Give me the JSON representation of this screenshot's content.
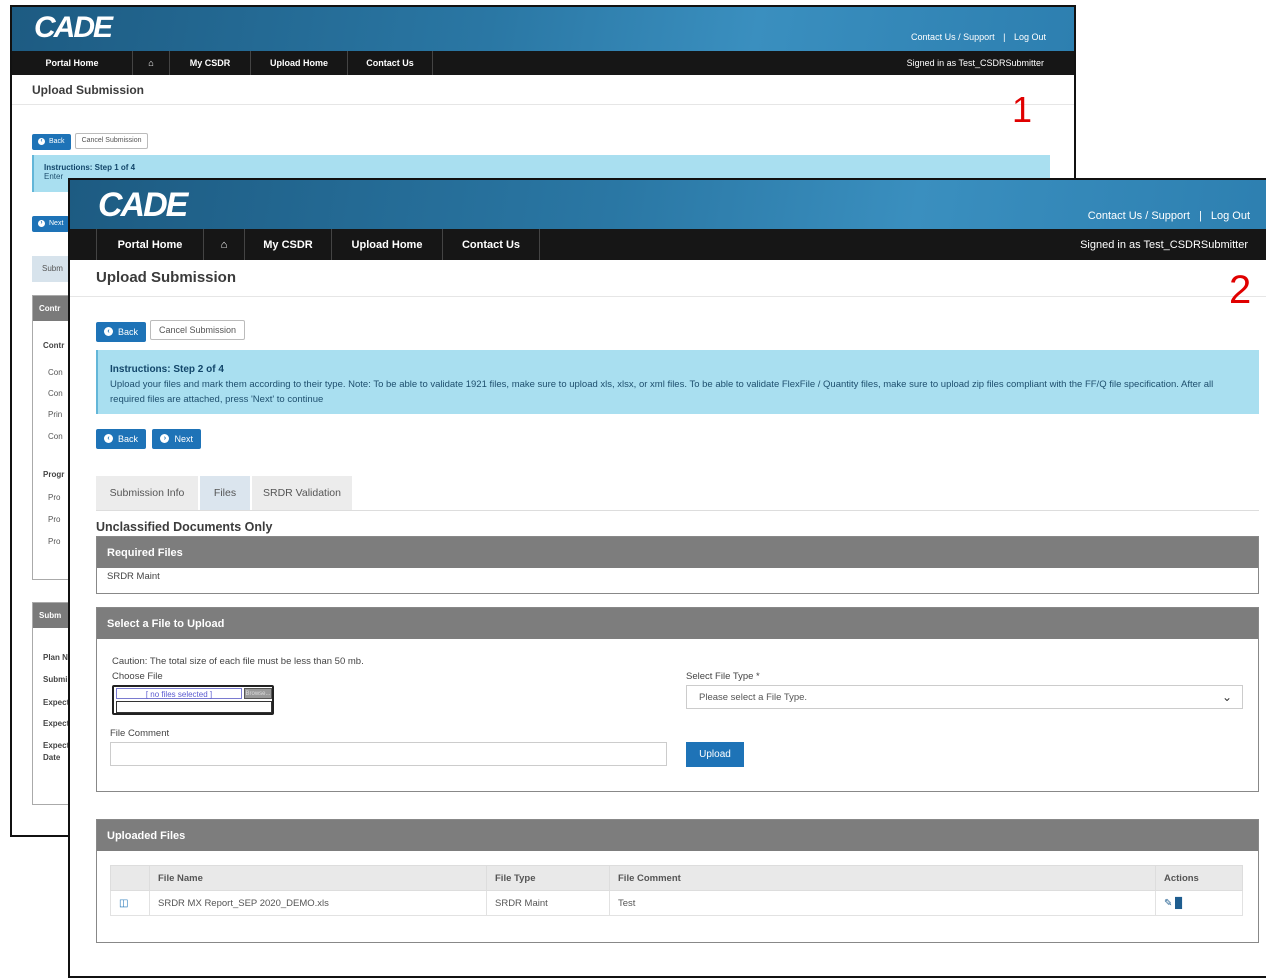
{
  "app": {
    "logo": "CADE"
  },
  "windows": [
    {
      "label": "1",
      "top_links": {
        "contact": "Contact Us / Support",
        "sep": "|",
        "logout": "Log Out"
      },
      "nav": [
        "Portal Home",
        "⌂",
        "My CSDR",
        "Upload Home",
        "Contact Us"
      ],
      "signed_in": "Signed in as Test_CSDRSubmitter",
      "page_title": "Upload Submission",
      "buttons": {
        "back": "Back",
        "cancel": "Cancel Submission",
        "next": "Next"
      },
      "instructions": {
        "title": "Instructions: Step 1 of 4",
        "text": "Enter"
      },
      "tab_stub": "Subm",
      "panel1": {
        "title": "Contr",
        "label_a": "Contr",
        "rows": [
          "Con",
          "Con",
          "Prin",
          "Con"
        ],
        "label_b": "Progr",
        "rows2": [
          "Pro",
          "Pro",
          "Pro"
        ]
      },
      "panel2": {
        "title": "Subm",
        "rows": [
          "Plan N",
          "Submi",
          "Expect",
          "Expect",
          "Expect",
          "Date"
        ]
      }
    },
    {
      "label": "2",
      "top_links": {
        "contact": "Contact Us / Support",
        "sep": "|",
        "logout": "Log Out"
      },
      "nav": [
        "Portal Home",
        "⌂",
        "My CSDR",
        "Upload Home",
        "Contact Us"
      ],
      "signed_in": "Signed in as Test_CSDRSubmitter",
      "page_title": "Upload Submission",
      "buttons": {
        "back": "Back",
        "cancel": "Cancel Submission",
        "next": "Next"
      },
      "instructions": {
        "title": "Instructions: Step 2 of 4",
        "text": "Upload your files and mark them according to their type. Note: To be able to validate 1921 files, make sure to upload xls, xlsx, or xml files. To be able to validate FlexFile / Quantity files, make sure to upload zip files compliant with the FF/Q file specification. After all required files are attached, press 'Next' to continue"
      },
      "tabs": [
        "Submission Info",
        "Files",
        "SRDR Validation"
      ],
      "active_tab": "Files",
      "section_title": "Unclassified Documents Only",
      "required_files": {
        "title": "Required Files",
        "items": [
          "SRDR Maint"
        ]
      },
      "select_file": {
        "title": "Select a File to Upload",
        "caution": "Caution: The total size of each file must be less than 50 mb.",
        "choose_label": "Choose File",
        "no_file": "[ no files selected ]",
        "browse": "Browse...",
        "type_label": "Select File Type *",
        "type_placeholder": "Please select a File Type.",
        "comment_label": "File Comment",
        "upload": "Upload"
      },
      "uploaded": {
        "title": "Uploaded Files",
        "columns": [
          "File Name",
          "File Type",
          "File Comment",
          "Actions"
        ],
        "rows": [
          {
            "name": "SRDR MX Report_SEP 2020_DEMO.xls",
            "type": "SRDR Maint",
            "comment": "Test"
          }
        ]
      }
    }
  ]
}
